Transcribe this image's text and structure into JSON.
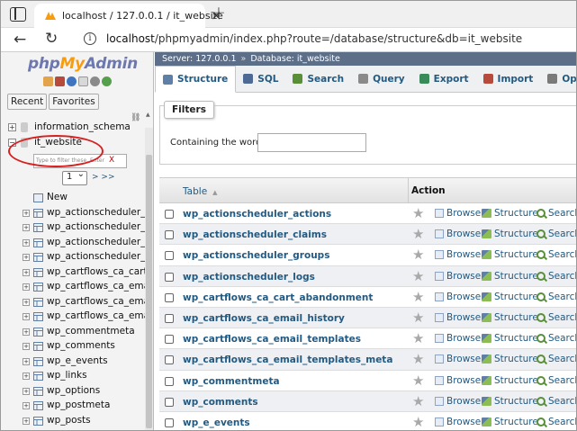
{
  "browser": {
    "tab_title": "localhost / 127.0.0.1 / it_website",
    "url_host": "localhost",
    "url_rest": "/phpmyadmin/index.php?route=/database/structure&db=it_website"
  },
  "nav": {
    "logo_php": "php",
    "logo_my": "My",
    "logo_admin": "Admin",
    "recent": "Recent",
    "favorites": "Favorites",
    "databases": [
      {
        "name": "information_schema",
        "expander": "+"
      },
      {
        "name": "it_website",
        "expander": "−"
      }
    ],
    "filter_placeholder": "Type to filter these, Enter",
    "filter_clear": "X",
    "page": "1",
    "page_next": "> >>",
    "new_label": "New",
    "tables": [
      "wp_actionscheduler_actio",
      "wp_actionscheduler_claim",
      "wp_actionscheduler_group",
      "wp_actionscheduler_logs",
      "wp_cartflows_ca_cart_aba",
      "wp_cartflows_ca_email_hi",
      "wp_cartflows_ca_email_te",
      "wp_cartflows_ca_email_te",
      "wp_commentmeta",
      "wp_comments",
      "wp_e_events",
      "wp_links",
      "wp_options",
      "wp_postmeta",
      "wp_posts"
    ]
  },
  "breadcrumb": {
    "server": "Server: 127.0.0.1",
    "sep": "»",
    "database": "Database: it_website"
  },
  "menu": [
    {
      "label": "Structure",
      "icon": "structure-icon",
      "active": true
    },
    {
      "label": "SQL",
      "icon": "sql-icon",
      "active": false
    },
    {
      "label": "Search",
      "icon": "search-icon",
      "active": false
    },
    {
      "label": "Query",
      "icon": "query-icon",
      "active": false
    },
    {
      "label": "Export",
      "icon": "export-icon",
      "active": false
    },
    {
      "label": "Import",
      "icon": "import-icon",
      "active": false
    },
    {
      "label": "Operations",
      "icon": "operations-icon",
      "active": false
    }
  ],
  "filters": {
    "legend": "Filters",
    "label": "Containing the word:",
    "value": ""
  },
  "table": {
    "col_table": "Table",
    "col_sort": "▲",
    "col_action": "Action",
    "browse": "Browse",
    "structure": "Structure",
    "search": "Search",
    "rows": [
      "wp_actionscheduler_actions",
      "wp_actionscheduler_claims",
      "wp_actionscheduler_groups",
      "wp_actionscheduler_logs",
      "wp_cartflows_ca_cart_abandonment",
      "wp_cartflows_ca_email_history",
      "wp_cartflows_ca_email_templates",
      "wp_cartflows_ca_email_templates_meta",
      "wp_commentmeta",
      "wp_comments",
      "wp_e_events"
    ]
  },
  "colors": {
    "link": "#235a81",
    "serverbar": "#5c6e88",
    "annotation_circle": "#d82020"
  }
}
